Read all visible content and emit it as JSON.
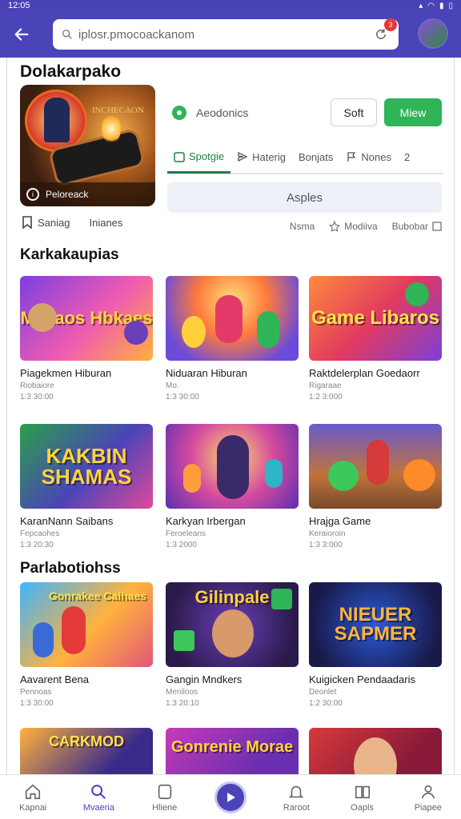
{
  "status": {
    "time": "12:05"
  },
  "search": {
    "value": "iplosr.pmocoackanom",
    "notification_count": "3"
  },
  "header": {
    "title": "Dolakarpako"
  },
  "hero": {
    "caption": "Peloreack",
    "overlay_text": "INCHECAON"
  },
  "under_hero": {
    "left_label": "Saniag",
    "right_label": "Inianes"
  },
  "status_row": {
    "label": "Aeodonics"
  },
  "buttons": {
    "soft_label": "Soft",
    "main_label": "Miew"
  },
  "tabs": [
    {
      "label": "Spotgie"
    },
    {
      "label": "Haterig"
    },
    {
      "label": "Bonjats"
    },
    {
      "label": "Nones"
    },
    {
      "label": "2"
    }
  ],
  "banner": {
    "label": "Asples"
  },
  "right_row": {
    "a": "Nsma",
    "b": "Modiiva",
    "c": "Bubobar"
  },
  "sections": {
    "first": "Karkakaupias",
    "second": "Parlabotiohss"
  },
  "cards": [
    {
      "thumb": "Makaos Hbkaes",
      "title": "Piagekmen Hiburan",
      "sub": "Riobaiore",
      "meta": "1:3 30:00"
    },
    {
      "thumb": "",
      "title": "Niduaran Hiburan",
      "sub": "Mo.",
      "meta": "1:3 30:00"
    },
    {
      "thumb": "Game Libaros",
      "title": "Raktdelerplan Goedaorr",
      "sub": "Rigaraae",
      "meta": "1:2 3:000"
    },
    {
      "thumb": "KAKBIN SHAMAS",
      "title": "KaranNann Saibans",
      "sub": "Fepcaohes",
      "meta": "1:3 20:30"
    },
    {
      "thumb": "",
      "title": "Karkyan Irbergan",
      "sub": "Feroeleans",
      "meta": "1:3 2000"
    },
    {
      "thumb": "",
      "title": "Hrajga Game",
      "sub": "Keraioroin",
      "meta": "1:3 3:000"
    },
    {
      "thumb": "Gonrakee Caihaes",
      "title": "Aavarent Bena",
      "sub": "Pennoas",
      "meta": "1:3 30:00"
    },
    {
      "thumb": "Gilinpale",
      "title": "Gangin Mndkers",
      "sub": "Meniloos",
      "meta": "1:3 20:10"
    },
    {
      "thumb": "NIEUER SAPMER",
      "title": "Kuigicken Pendaadaris",
      "sub": "Deonlet",
      "meta": "1:2 30:00"
    },
    {
      "thumb": "CARKMOD",
      "title": "",
      "sub": "",
      "meta": ""
    },
    {
      "thumb": "Gonrenie Morae",
      "title": "",
      "sub": "",
      "meta": ""
    },
    {
      "thumb": "",
      "title": "",
      "sub": "",
      "meta": ""
    }
  ],
  "nav": [
    {
      "label": "Kapnai"
    },
    {
      "label": "Mvaeria"
    },
    {
      "label": "Hliene"
    },
    {
      "label": "Raroot"
    },
    {
      "label": "Oapls"
    },
    {
      "label": "Piapee"
    }
  ],
  "colors": {
    "brand": "#4b44b8",
    "accent_green": "#2fb457",
    "tab_active": "#1e7f47"
  }
}
